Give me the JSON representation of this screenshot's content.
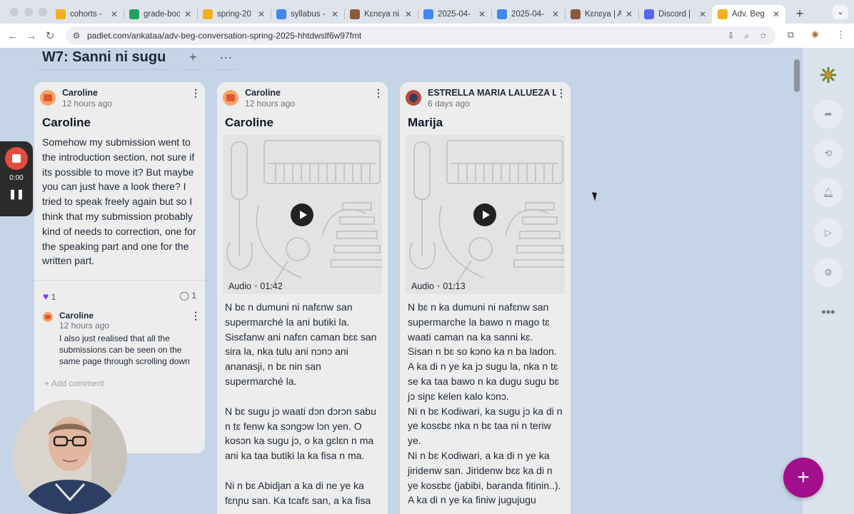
{
  "tabs": [
    {
      "label": "cohorts -",
      "color": "#f2b01e"
    },
    {
      "label": "grade-boo",
      "color": "#1ea362"
    },
    {
      "label": "spring-20",
      "color": "#f2b01e"
    },
    {
      "label": "syllabus -",
      "color": "#4285f4"
    },
    {
      "label": "Kɛnɛya ni",
      "color": "#8a5a3c"
    },
    {
      "label": "2025-04-",
      "color": "#4285f4"
    },
    {
      "label": "2025-04-",
      "color": "#4285f4"
    },
    {
      "label": "Kɛnɛya | A",
      "color": "#8a5a3c"
    },
    {
      "label": "Discord | ",
      "color": "#5865f2"
    },
    {
      "label": "Adv. Beg",
      "color": "#f2b01e",
      "active": true
    }
  ],
  "address_bar": {
    "url": "padlet.com/ankataa/adv-beg-conversation-spring-2025-hhtdwslf6w97fmt"
  },
  "section": {
    "title": "W7: Sanni ni sugu",
    "add_label": "+",
    "more_label": "···"
  },
  "cards": [
    {
      "author": "Caroline",
      "time": "12 hours ago",
      "title": "Caroline",
      "body": "Somehow my submission went to the introduction section, not sure if its possible to move it? But maybe you can just have a look there? I tried to speak freely again but so I think that my submission probably kind of needs to correction, one for the speaking part and one for the written part.",
      "likes": "1",
      "comments": "1",
      "comment": {
        "author": "Caroline",
        "time": "12 hours ago",
        "text": "I also just realised that all the submissions can be seen on the same page through scrolling down"
      },
      "add_comment": "Add comment"
    },
    {
      "author": "Caroline",
      "time": "12 hours ago",
      "title": "Caroline",
      "audio": {
        "label": "Audio",
        "duration": "01:42"
      },
      "body_paragraphs": [
        "N bɛ n dumuni ni nafɛnw san supermarché la ani butiki la. Sisɛfanw ani nafɛn caman bɛɛ san sira la, nka tulu ani nɔnɔ ani ananasji, n bɛ nin san supermarché la.",
        "N bɛ sugu jɔ waati dɔn dɔrɔn sabu n tɛ fenw ka sɔngɔw lɔn yen. O kosɔn ka sugu jɔ, o ka gɛlɛn n ma ani ka taa butiki la ka fisa n ma.",
        "Ni n bɛ Abidjan a ka di ne ye ka fɛnɲu san. Ka tcafɛ san, a ka fisa"
      ]
    },
    {
      "author": "ESTRELLA MARIA LALUEZA LA",
      "time": "6 days ago",
      "title": "Marija",
      "audio": {
        "label": "Audio",
        "duration": "01:13"
      },
      "body_lines": [
        "N bɛ n ka dumuni ni nafɛnw san supermarche la bawo n mago tɛ waati caman na ka sanni kɛ.",
        "Sisan n bɛ so kɔno ka n ba ladon.",
        "A ka di n ye ka jɔ sugu la, nka n tɛ se ka taa bawo n ka dugu sugu bɛ jɔ siɲɛ kelen kalo kɔnɔ.",
        "Ni n bɛ Kodiwari, ka sugu jɔ ka di n ye kosɛbɛ nka n bɛ taa ni n teriw ye.",
        "Ni n bɛ Kodiwari, a ka di n ye ka jiridenw san. Jiridenw bɛɛ ka di n ye kosɛbɛ (jabibi, baranda fitinin..).",
        "A ka di n ye ka finiw jugujugu"
      ]
    }
  ],
  "recorder": {
    "time": "0:00",
    "pause_label": "❚❚"
  },
  "fab_label": "+"
}
